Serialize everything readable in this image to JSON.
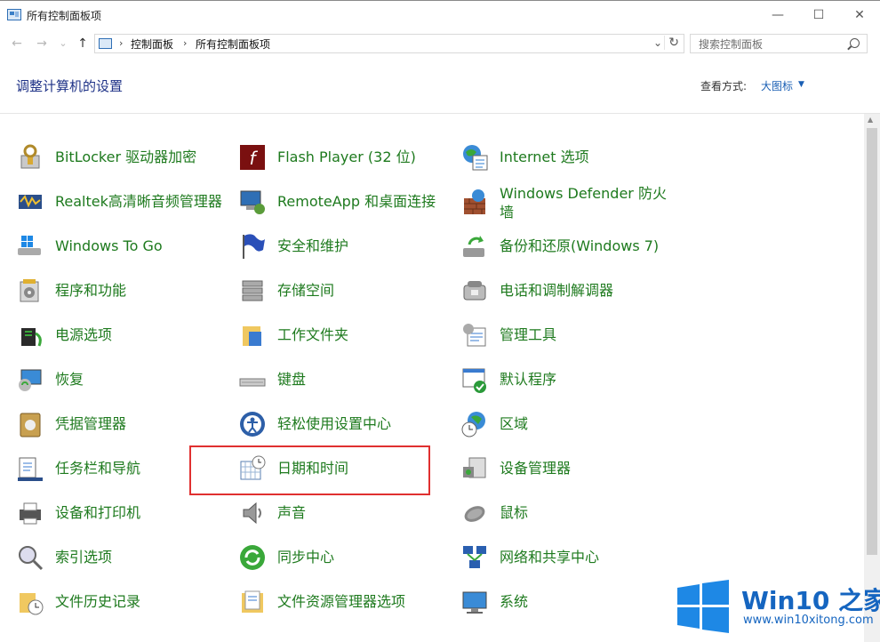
{
  "window": {
    "title": "所有控制面板项",
    "minimize": "—",
    "maximize": "☐",
    "close": "✕"
  },
  "nav": {
    "back": "←",
    "forward": "→",
    "recent": "⌄",
    "up": "↑"
  },
  "address": {
    "crumbs": [
      "控制面板",
      "所有控制面板项"
    ],
    "dropdown": "⌄",
    "refresh": "↻"
  },
  "search": {
    "placeholder": "搜索控制面板"
  },
  "header": {
    "title": "调整计算机的设置",
    "view_by_label": "查看方式:",
    "view_by_value": "大图标",
    "view_caret": "▼"
  },
  "items": [
    {
      "label": "BitLocker 驱动器加密",
      "icon": "bitlocker-icon"
    },
    {
      "label": "Flash Player (32 位)",
      "icon": "flash-icon"
    },
    {
      "label": "Internet 选项",
      "icon": "internet-options-icon"
    },
    {
      "label": "Realtek高清晰音频管理器",
      "icon": "realtek-audio-icon"
    },
    {
      "label": "RemoteApp 和桌面连接",
      "icon": "remoteapp-icon"
    },
    {
      "label": "Windows Defender 防火墙",
      "icon": "firewall-icon"
    },
    {
      "label": "Windows To Go",
      "icon": "windows-to-go-icon"
    },
    {
      "label": "安全和维护",
      "icon": "flag-icon"
    },
    {
      "label": "备份和还原(Windows 7)",
      "icon": "backup-icon"
    },
    {
      "label": "程序和功能",
      "icon": "programs-icon"
    },
    {
      "label": "存储空间",
      "icon": "storage-icon"
    },
    {
      "label": "电话和调制解调器",
      "icon": "phone-modem-icon"
    },
    {
      "label": "电源选项",
      "icon": "power-icon"
    },
    {
      "label": "工作文件夹",
      "icon": "work-folders-icon"
    },
    {
      "label": "管理工具",
      "icon": "admin-tools-icon"
    },
    {
      "label": "恢复",
      "icon": "recovery-icon"
    },
    {
      "label": "键盘",
      "icon": "keyboard-icon"
    },
    {
      "label": "默认程序",
      "icon": "default-programs-icon"
    },
    {
      "label": "凭据管理器",
      "icon": "credential-icon"
    },
    {
      "label": "轻松使用设置中心",
      "icon": "ease-of-access-icon"
    },
    {
      "label": "区域",
      "icon": "region-icon"
    },
    {
      "label": "任务栏和导航",
      "icon": "taskbar-icon"
    },
    {
      "label": "日期和时间",
      "icon": "date-time-icon"
    },
    {
      "label": "设备管理器",
      "icon": "device-manager-icon"
    },
    {
      "label": "设备和打印机",
      "icon": "printer-icon"
    },
    {
      "label": "声音",
      "icon": "sound-icon"
    },
    {
      "label": "鼠标",
      "icon": "mouse-icon"
    },
    {
      "label": "索引选项",
      "icon": "indexing-icon"
    },
    {
      "label": "同步中心",
      "icon": "sync-icon"
    },
    {
      "label": "网络和共享中心",
      "icon": "network-icon"
    },
    {
      "label": "文件历史记录",
      "icon": "file-history-icon"
    },
    {
      "label": "文件资源管理器选项",
      "icon": "explorer-options-icon"
    },
    {
      "label": "系统",
      "icon": "system-icon"
    }
  ],
  "watermark": {
    "title": "Win10 之家",
    "url": "www.win10xitong.com"
  },
  "colors": {
    "link_green": "#1e7a1e",
    "heading_blue": "#1e3287",
    "highlight_red": "#e03030",
    "watermark_blue": "#1565c0"
  }
}
